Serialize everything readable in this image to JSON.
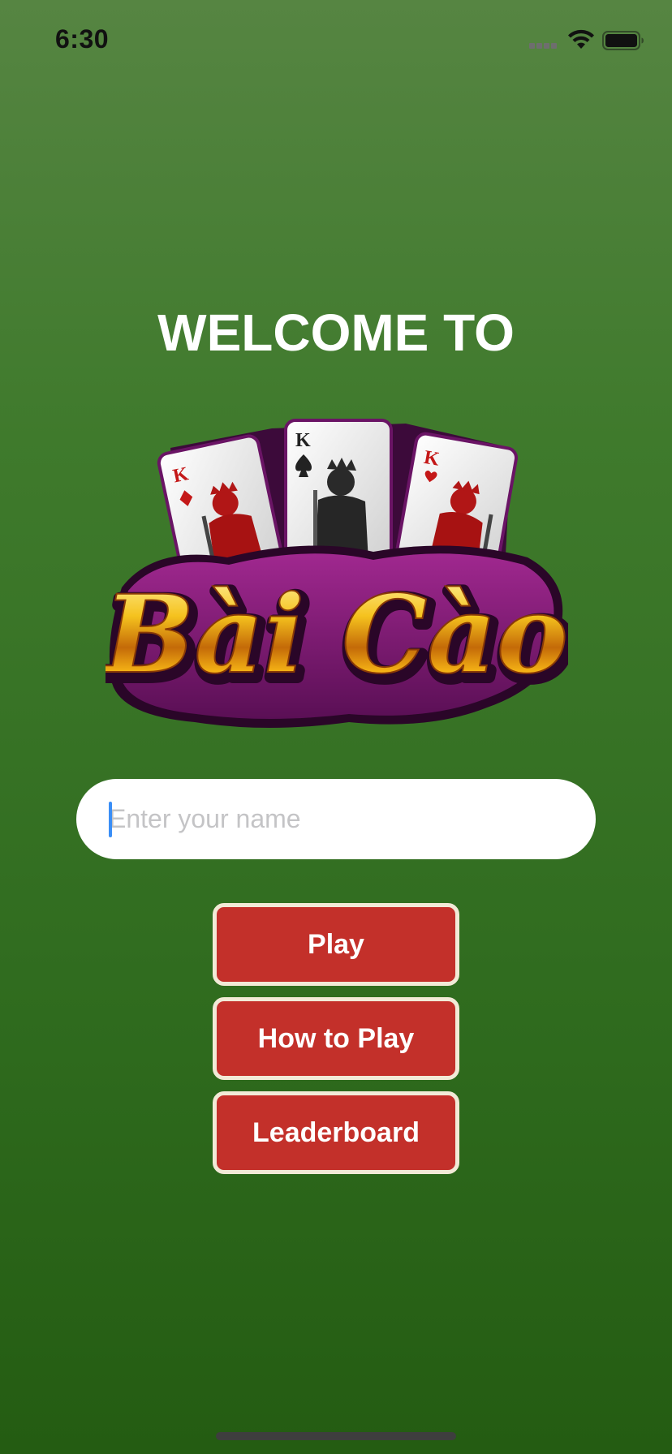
{
  "status_bar": {
    "time": "6:30"
  },
  "welcome": {
    "title": "WELCOME TO"
  },
  "logo": {
    "text": "Bài Cào",
    "card_rank": "K"
  },
  "name_input": {
    "placeholder": "Enter your name",
    "value": ""
  },
  "menu": {
    "play_label": "Play",
    "how_to_play_label": "How to Play",
    "leaderboard_label": "Leaderboard"
  },
  "colors": {
    "background_top": "#568542",
    "background_bottom": "#245c12",
    "button_fill": "#c3302a",
    "button_border": "#f2ead7",
    "logo_purple": "#7a1a72",
    "logo_gold": "#f0b020"
  },
  "icons": {
    "signal": "cellular-signal-icon",
    "wifi": "wifi-icon",
    "battery": "battery-icon"
  }
}
